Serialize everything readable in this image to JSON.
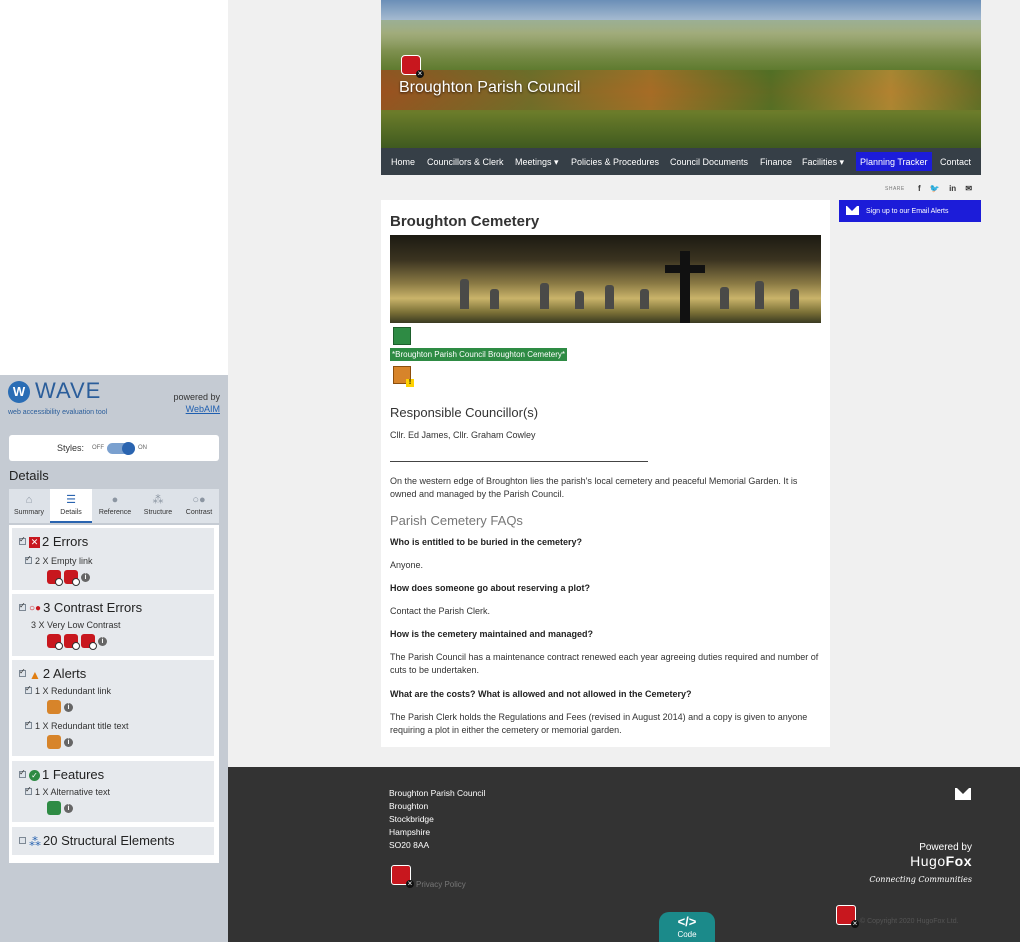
{
  "wave": {
    "logo_letter": "W",
    "title": "WAVE",
    "subtitle": "web accessibility evaluation tool",
    "powered_by": "powered by",
    "powered_link": "WebAIM",
    "styles_label": "Styles:",
    "styles_off": "OFF",
    "styles_on": "ON",
    "details_heading": "Details",
    "tabs": [
      {
        "label": "Summary",
        "icon": "home-icon"
      },
      {
        "label": "Details",
        "icon": "list-icon",
        "active": true
      },
      {
        "label": "Reference",
        "icon": "info-icon"
      },
      {
        "label": "Structure",
        "icon": "hierarchy-icon"
      },
      {
        "label": "Contrast",
        "icon": "contrast-icon"
      }
    ],
    "errors": {
      "heading": "2 Errors",
      "items": [
        {
          "label": "2 X Empty link",
          "count": 2
        }
      ]
    },
    "contrast": {
      "heading": "3 Contrast Errors",
      "items": [
        {
          "label": "3 X Very Low Contrast",
          "count": 3
        }
      ]
    },
    "alerts": {
      "heading": "2 Alerts",
      "items": [
        {
          "label": "1 X Redundant link",
          "count": 1
        },
        {
          "label": "1 X Redundant title text",
          "count": 1
        }
      ]
    },
    "features": {
      "heading": "1 Features",
      "items": [
        {
          "label": "1 X Alternative text",
          "count": 1
        }
      ]
    },
    "structure": {
      "heading": "20 Structural Elements"
    },
    "colors": {
      "error": "#c8171e",
      "alert": "#d7842a",
      "feature": "#2e8b44",
      "accent": "#2a64b0"
    }
  },
  "site": {
    "title": "Broughton Parish Council",
    "nav": [
      "Home",
      "Councillors & Clerk",
      "Meetings ▾",
      "Policies & Procedures",
      "Council Documents",
      "Finance",
      "Facilities ▾",
      "Planning Tracker",
      "Contact"
    ],
    "share_label": "SHARE",
    "share_icons": [
      "f",
      "🐦",
      "in",
      "✉"
    ],
    "email_alerts": "Sign up to our Email Alerts",
    "page_title": "Broughton Cemetery",
    "alt_text": "*Broughton Parish Council Broughton Cemetery*",
    "responsible_heading": "Responsible Councillor(s)",
    "councillors": "Cllr. Ed James, Cllr. Graham Cowley",
    "intro": "On the western edge of Broughton lies the parish's local cemetery and peaceful Memorial Garden.  It is owned and managed by the Parish Council.",
    "faq_heading": "Parish Cemetery FAQs",
    "faqs": [
      {
        "q": "Who is entitled to be buried in the cemetery?",
        "a": "Anyone."
      },
      {
        "q": "How does someone go about reserving a plot?",
        "a": "Contact the Parish Clerk."
      },
      {
        "q": "How is the cemetery maintained and managed?",
        "a": "The Parish Council has a maintenance contract renewed each year agreeing duties required and number of cuts to be undertaken."
      },
      {
        "q": "What are the costs? What is allowed and not allowed in the Cemetery?",
        "a": "The Parish Clerk holds the Regulations and Fees (revised in August 2014) and a copy is given to anyone requiring a plot in either the cemetery or memorial garden."
      }
    ]
  },
  "footer": {
    "address": [
      "Broughton Parish Council",
      "Broughton",
      "Stockbridge",
      "Hampshire",
      "SO20 8AA"
    ],
    "privacy": "Privacy Policy",
    "powered_by": "Powered by",
    "brand_a": "Hugo",
    "brand_b": "Fox",
    "tagline": "Connecting Communities",
    "copyright": "© Copyright 2020 HugoFox Ltd.",
    "code_glyph": "</>",
    "code_label": "Code"
  }
}
